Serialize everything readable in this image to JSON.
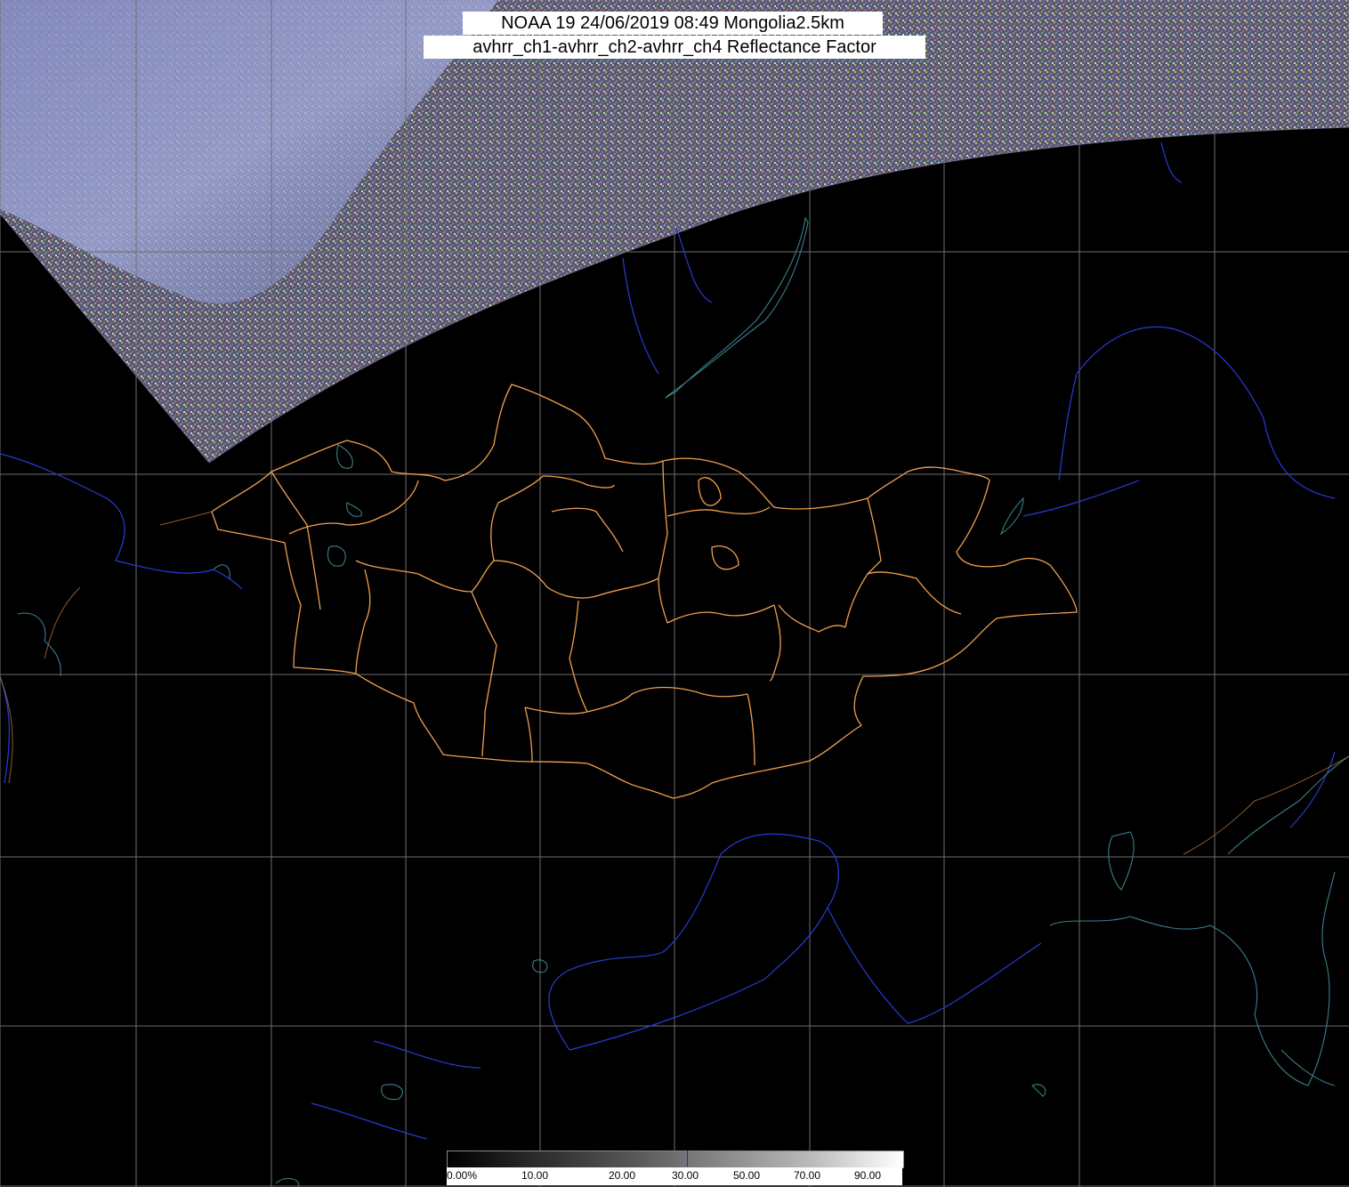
{
  "title": {
    "line1": "NOAA 19 24/06/2019 08:49 Mongolia2.5km",
    "line2": "avhrr_ch1-avhrr_ch2-avhrr_ch4 Reflectance Factor"
  },
  "colorbar": {
    "labels": [
      "0.00%",
      "10.00",
      "20.00",
      "30.00",
      "50.00",
      "70.00",
      "90.00"
    ],
    "marker_value": 30
  },
  "colors": {
    "background": "#000000",
    "grid": "#6e6e6e",
    "country_border": "#f0a050",
    "coastline": "#3a7f8a",
    "rivers": "#2a3ad8"
  },
  "map": {
    "grid_lines": true,
    "layers": [
      "satellite-swath",
      "graticule",
      "mongolia-province-borders",
      "coastlines",
      "rivers",
      "lakes"
    ]
  }
}
